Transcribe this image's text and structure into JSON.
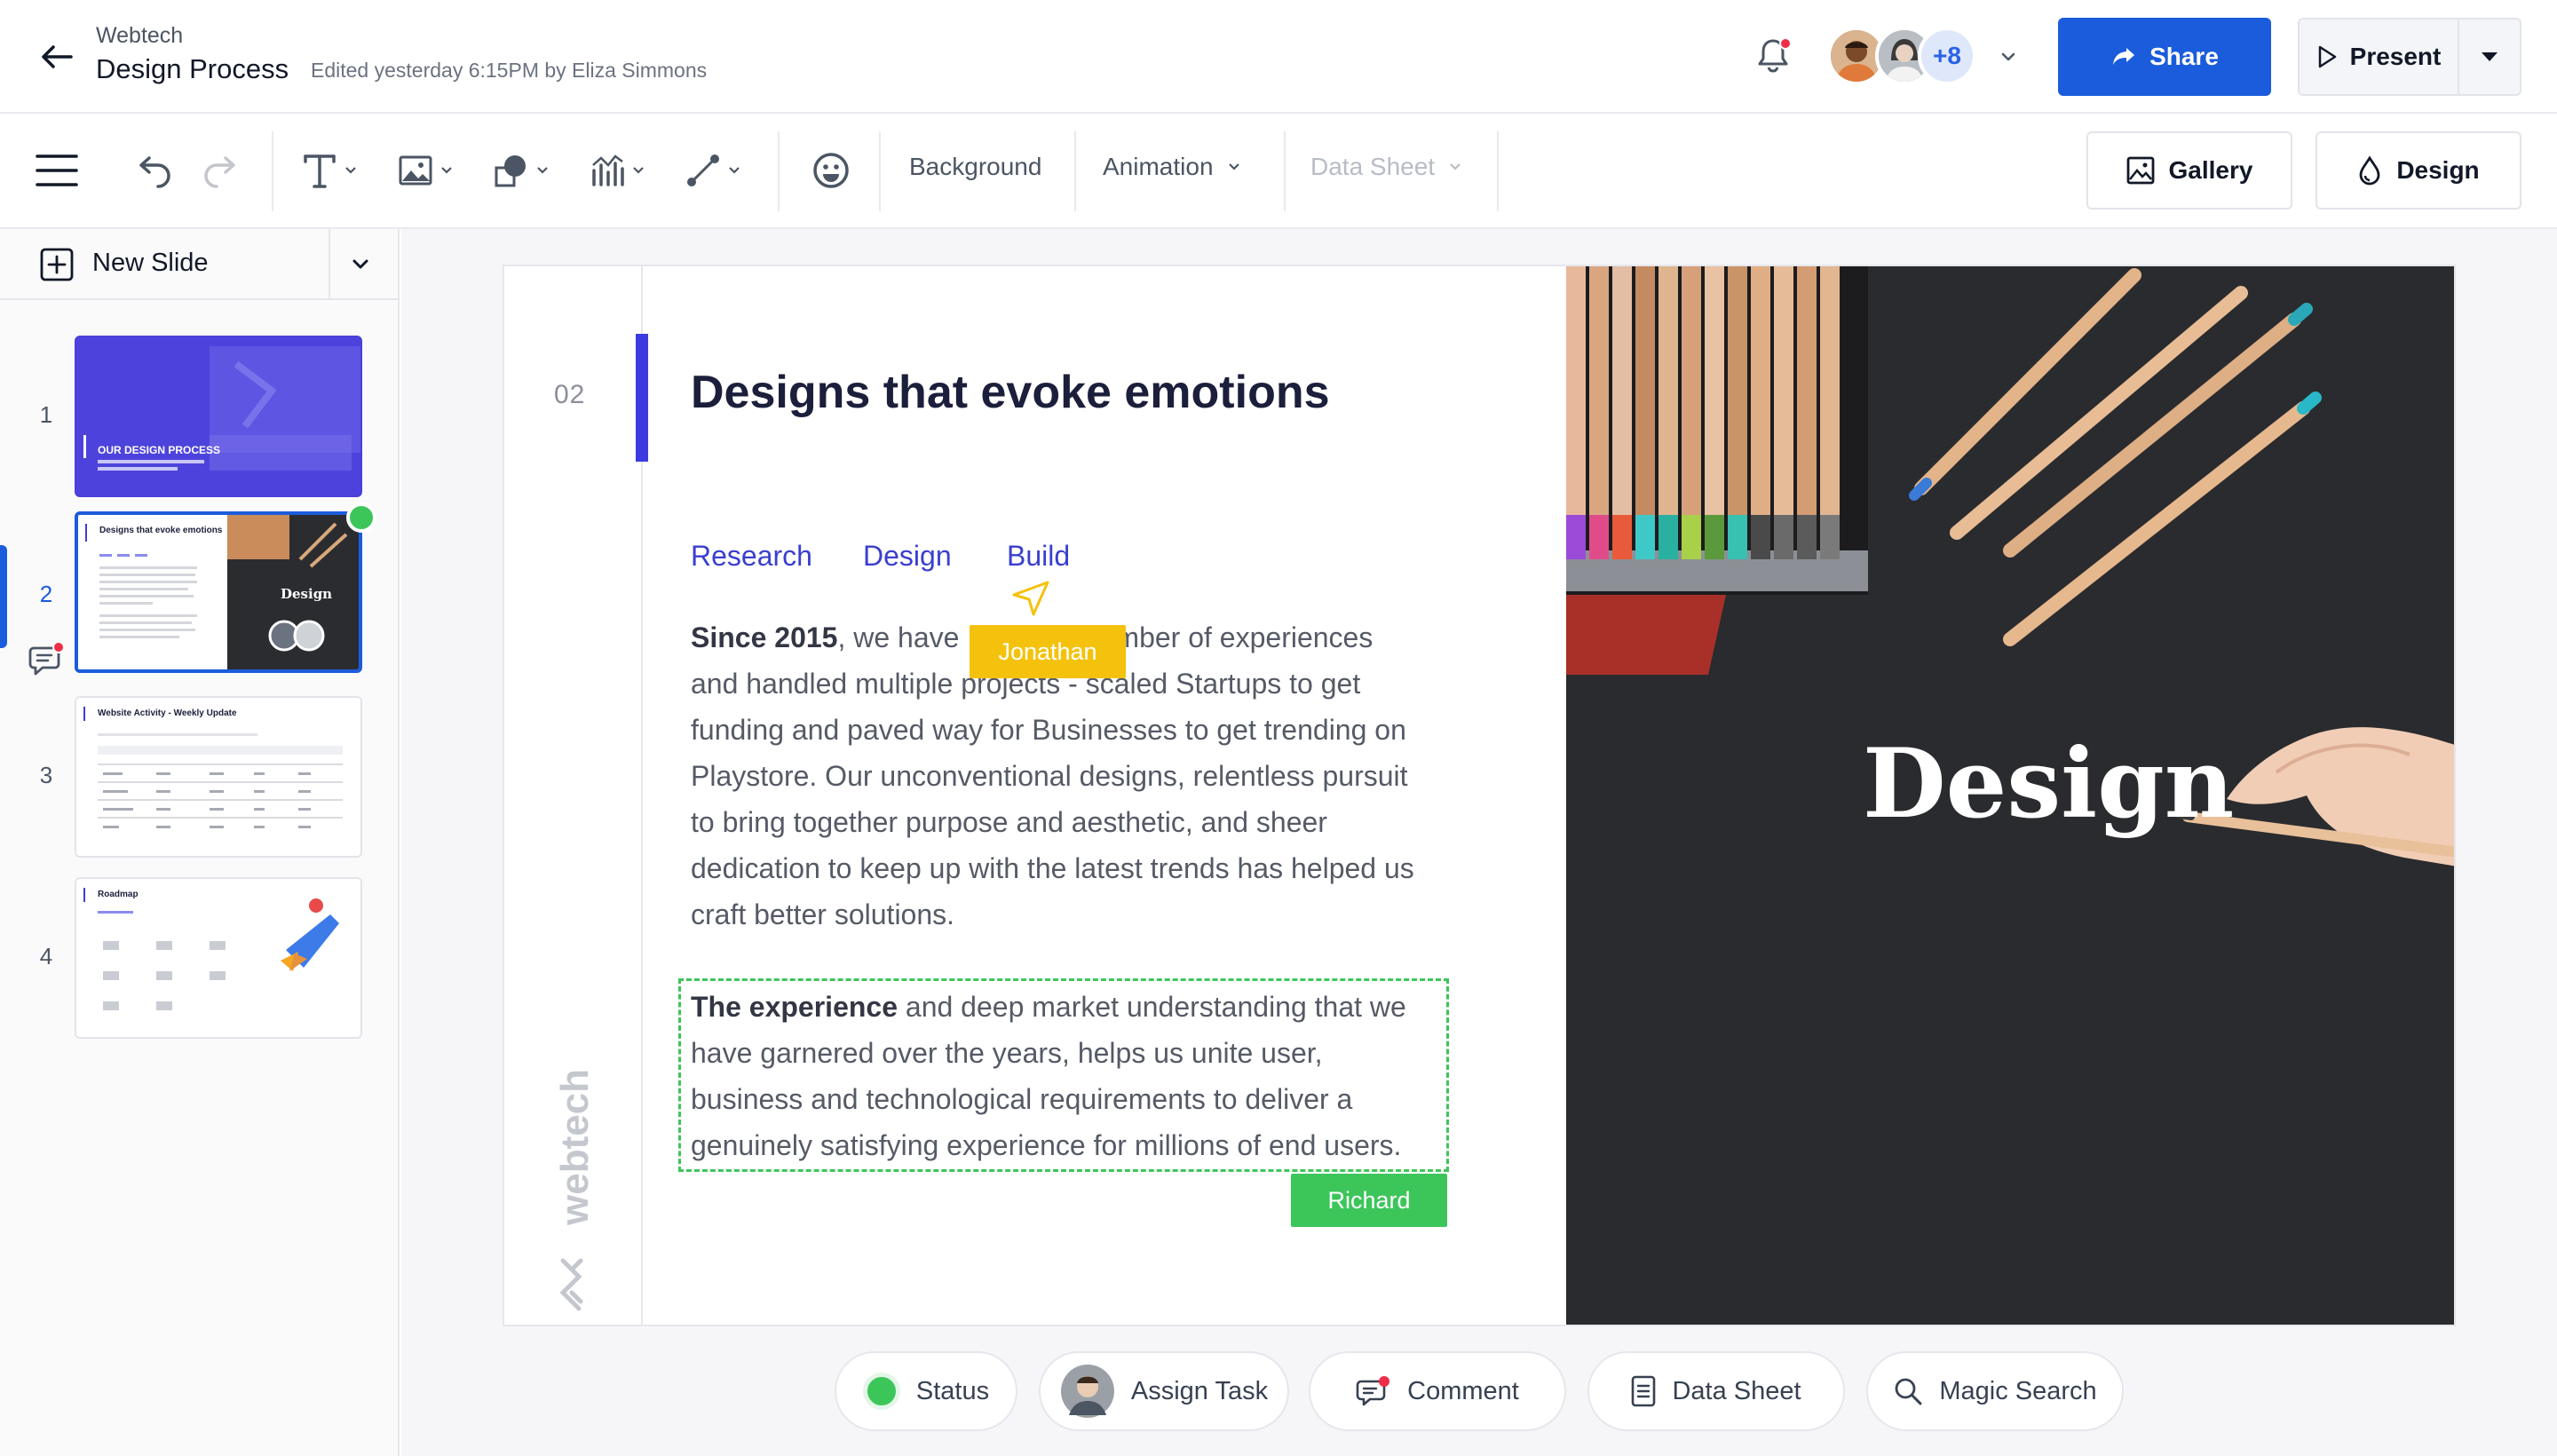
{
  "header": {
    "org": "Webtech",
    "title": "Design Process",
    "edited": "Edited yesterday 6:15PM by Eliza Simmons",
    "collaborators_more": "+8",
    "share_label": "Share",
    "present_label": "Present"
  },
  "toolbar": {
    "background_label": "Background",
    "animation_label": "Animation",
    "datasheet_label": "Data Sheet",
    "gallery_label": "Gallery",
    "design_label": "Design"
  },
  "sidebar": {
    "new_slide_label": "New Slide",
    "slides": [
      {
        "num": "1",
        "title": "OUR DESIGN PROCESS"
      },
      {
        "num": "2",
        "title": "Designs that evoke emotions"
      },
      {
        "num": "3",
        "title": "Website Activity - Weekly Update"
      },
      {
        "num": "4",
        "title": "Roadmap"
      }
    ]
  },
  "slide": {
    "number": "02",
    "title": "Designs that evoke emotions",
    "tabs": [
      "Research",
      "Design",
      "Build"
    ],
    "para1_bold": "Since 2015",
    "para1_line1_pre": ", we have",
    "para1_line1_post": "mber of experiences",
    "para1_rest": "and handled multiple projects - scaled Startups to get funding and paved way for Businesses to get trending on Playstore. Our unconventional designs, relentless pursuit to bring together purpose and aesthetic, and sheer dedication to keep up with the latest trends has helped us craft better solutions.",
    "para2_bold": "The experience",
    "para2_rest": " and deep market understanding that we have garnered over the years, helps us unite user, business and technological requirements to deliver a genuinely satisfying experience for millions of end users.",
    "cursor_jonathan": "Jonathan",
    "cursor_richard": "Richard",
    "brand_vertical": "webtech",
    "image_word": "Design"
  },
  "bottom": {
    "status": "Status",
    "assign_task": "Assign Task",
    "comment": "Comment",
    "data_sheet": "Data Sheet",
    "magic_search": "Magic Search",
    "help": "?"
  },
  "colors": {
    "accent": "#1a5cdc",
    "slide_accent": "#3d3be0",
    "online": "#3cc65a",
    "cursor_yellow": "#f4c20d",
    "alert": "#ef2d46"
  }
}
